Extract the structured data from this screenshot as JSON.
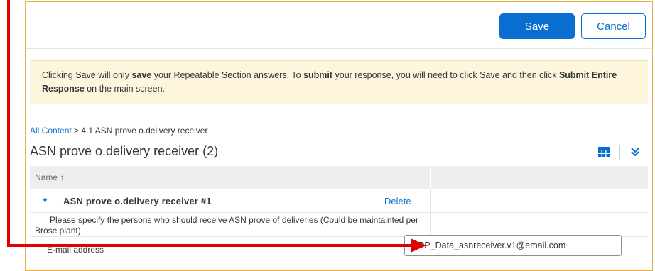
{
  "toolbar": {
    "save_label": "Save",
    "cancel_label": "Cancel"
  },
  "notice": {
    "part1": "Clicking Save will only ",
    "bold1": "save",
    "part2": " your Repeatable Section answers. To ",
    "bold2": "submit",
    "part3": " your response, you will need to click Save and then click ",
    "bold3": "Submit Entire Response",
    "part4": " on the main screen."
  },
  "breadcrumb": {
    "root": "All Content",
    "separator": " > ",
    "current": "4.1 ASN prove o.delivery receiver"
  },
  "section": {
    "title": "ASN prove o.delivery receiver (2)"
  },
  "icons": {
    "grid": "table-view-icon",
    "expand": "double-chevron-down-icon"
  },
  "table": {
    "header_name": "Name ↑",
    "row": {
      "title": "ASN prove o.delivery receiver #1",
      "delete_label": "Delete",
      "description": "Please specify the persons who should receive ASN prove of deliveries (Could be maintainted per Brose plant).",
      "email_label": "E-mail address",
      "email_value": "ERP_Data_asnreceiver.v1@email.com"
    }
  },
  "colors": {
    "accent": "#0a6ed1",
    "notice_bg": "#fdf6dd",
    "panel_border": "#e8b040",
    "annotation": "#e00000"
  }
}
